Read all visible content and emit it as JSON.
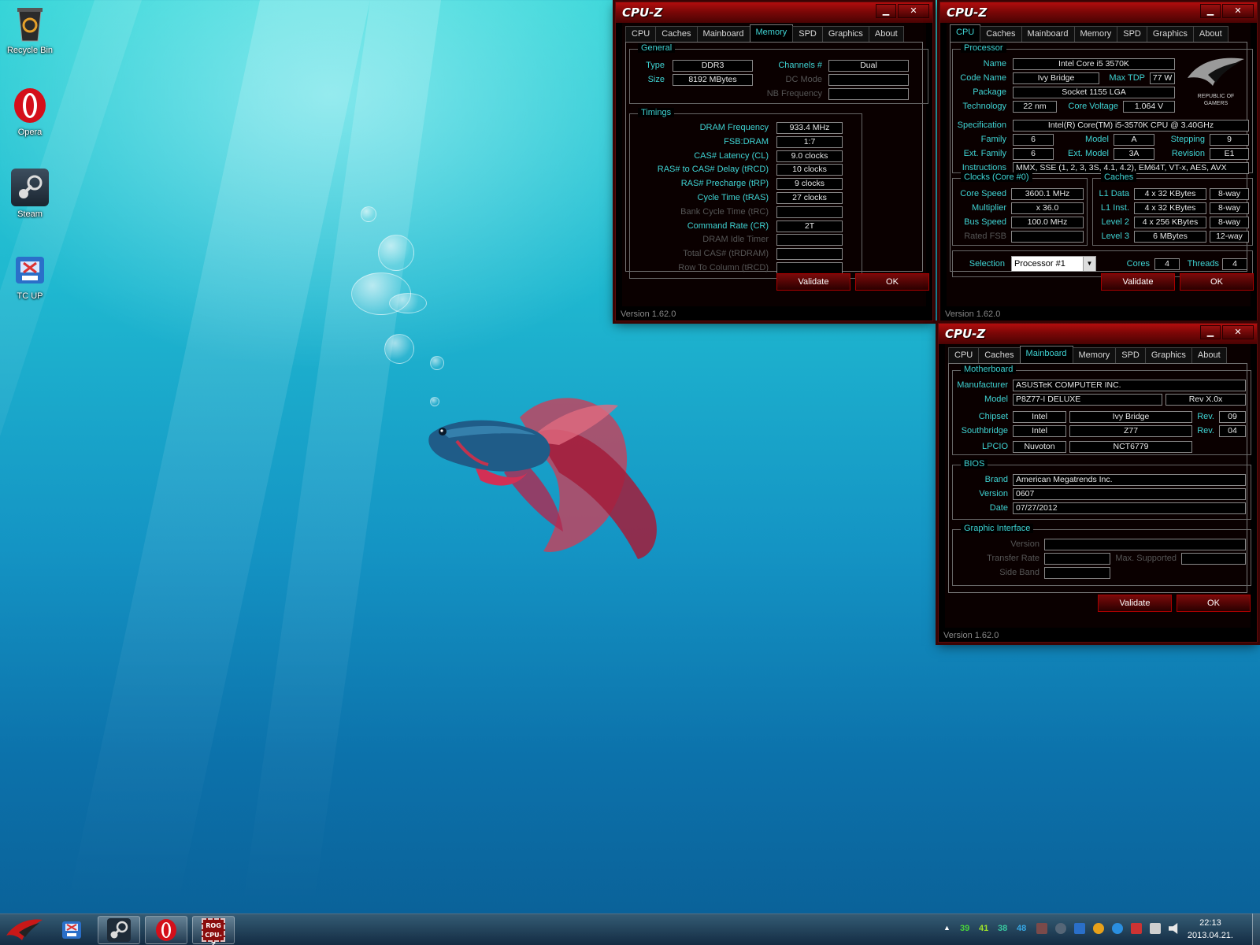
{
  "desktop": {
    "icons": [
      {
        "label": "Recycle Bin",
        "icon": "recycle-bin-icon"
      },
      {
        "label": "Opera",
        "icon": "opera-icon"
      },
      {
        "label": "Steam",
        "icon": "steam-icon"
      },
      {
        "label": "TC UP",
        "icon": "tc-up-icon"
      }
    ]
  },
  "common": {
    "window_title": "CPU-Z",
    "tabs": [
      "CPU",
      "Caches",
      "Mainboard",
      "Memory",
      "SPD",
      "Graphics",
      "About"
    ],
    "validate": "Validate",
    "ok": "OK",
    "version": "Version 1.62.0",
    "min_glyph": "▁",
    "close_glyph": "✕"
  },
  "memory": {
    "general_title": "General",
    "type_label": "Type",
    "type": "DDR3",
    "size_label": "Size",
    "size": "8192 MBytes",
    "channels_label": "Channels #",
    "channels": "Dual",
    "dcmode_label": "DC Mode",
    "dcmode": "",
    "nbfreq_label": "NB Frequency",
    "nbfreq": "",
    "timings_title": "Timings",
    "timings": [
      {
        "label": "DRAM Frequency",
        "value": "933.4 MHz",
        "dim": false
      },
      {
        "label": "FSB:DRAM",
        "value": "1:7",
        "dim": false
      },
      {
        "label": "CAS# Latency (CL)",
        "value": "9.0 clocks",
        "dim": false
      },
      {
        "label": "RAS# to CAS# Delay (tRCD)",
        "value": "10 clocks",
        "dim": false
      },
      {
        "label": "RAS# Precharge (tRP)",
        "value": "9 clocks",
        "dim": false
      },
      {
        "label": "Cycle Time (tRAS)",
        "value": "27 clocks",
        "dim": false
      },
      {
        "label": "Bank Cycle Time (tRC)",
        "value": "",
        "dim": true
      },
      {
        "label": "Command Rate (CR)",
        "value": "2T",
        "dim": false
      },
      {
        "label": "DRAM Idle Timer",
        "value": "",
        "dim": true
      },
      {
        "label": "Total CAS# (tRDRAM)",
        "value": "",
        "dim": true
      },
      {
        "label": "Row To Column (tRCD)",
        "value": "",
        "dim": true
      }
    ]
  },
  "cpu": {
    "processor_title": "Processor",
    "name_label": "Name",
    "name": "Intel Core i5 3570K",
    "codename_label": "Code Name",
    "codename": "Ivy Bridge",
    "maxtdp_label": "Max TDP",
    "maxtdp": "77 W",
    "package_label": "Package",
    "package": "Socket 1155 LGA",
    "technology_label": "Technology",
    "technology": "22 nm",
    "corevoltage_label": "Core Voltage",
    "corevoltage": "1.064 V",
    "spec_label": "Specification",
    "spec": "Intel(R) Core(TM) i5-3570K CPU @ 3.40GHz",
    "family_label": "Family",
    "family": "6",
    "model_label": "Model",
    "model": "A",
    "stepping_label": "Stepping",
    "stepping": "9",
    "extfamily_label": "Ext. Family",
    "extfamily": "6",
    "extmodel_label": "Ext. Model",
    "extmodel": "3A",
    "revision_label": "Revision",
    "revision": "E1",
    "instructions_label": "Instructions",
    "instructions": "MMX, SSE (1, 2, 3, 3S, 4.1, 4.2), EM64T, VT-x, AES, AVX",
    "logo_text_1": "REPUBLIC OF",
    "logo_text_2": "GAMERS",
    "clocks_title": "Clocks (Core #0)",
    "corespeed_label": "Core Speed",
    "corespeed": "3600.1 MHz",
    "multiplier_label": "Multiplier",
    "multiplier": "x 36.0",
    "busspeed_label": "Bus Speed",
    "busspeed": "100.0 MHz",
    "ratedfsb_label": "Rated FSB",
    "ratedfsb": "",
    "caches_title": "Caches",
    "l1data_label": "L1 Data",
    "l1data": "4 x 32 KBytes",
    "l1data_way": "8-way",
    "l1inst_label": "L1 Inst.",
    "l1inst": "4 x 32 KBytes",
    "l1inst_way": "8-way",
    "l2_label": "Level 2",
    "l2": "4 x 256 KBytes",
    "l2_way": "8-way",
    "l3_label": "Level 3",
    "l3": "6 MBytes",
    "l3_way": "12-way",
    "selection_label": "Selection",
    "selection": "Processor #1",
    "cores_label": "Cores",
    "cores": "4",
    "threads_label": "Threads",
    "threads": "4"
  },
  "mainboard": {
    "mb_title": "Motherboard",
    "manufacturer_label": "Manufacturer",
    "manufacturer": "ASUSTeK COMPUTER INC.",
    "model_label": "Model",
    "model": "P8Z77-I DELUXE",
    "model_rev": "Rev X.0x",
    "chipset_label": "Chipset",
    "chipset_vendor": "Intel",
    "chipset": "Ivy Bridge",
    "chipset_rev_label": "Rev.",
    "chipset_rev": "09",
    "southbridge_label": "Southbridge",
    "sb_vendor": "Intel",
    "sb": "Z77",
    "sb_rev_label": "Rev.",
    "sb_rev": "04",
    "lpcio_label": "LPCIO",
    "lpcio_vendor": "Nuvoton",
    "lpcio": "NCT6779",
    "bios_title": "BIOS",
    "brand_label": "Brand",
    "brand": "American Megatrends Inc.",
    "version_label": "Version",
    "version": "0607",
    "date_label": "Date",
    "date": "07/27/2012",
    "gi_title": "Graphic Interface",
    "gi_version_label": "Version",
    "gi_version": "",
    "gi_transfer_label": "Transfer Rate",
    "gi_transfer": "",
    "gi_max_label": "Max. Supported",
    "gi_max": "",
    "gi_sideband_label": "Side Band",
    "gi_sideband": ""
  },
  "taskbar": {
    "pinned": [
      "rog-start-icon",
      "tc-up-icon",
      "steam-icon",
      "opera-icon",
      "cpu-z-icon"
    ],
    "cpuz_badge": "ROG CPU-Z",
    "tray_numbers": [
      {
        "value": "39",
        "color": "#49d33b"
      },
      {
        "value": "41",
        "color": "#9fe32a"
      },
      {
        "value": "38",
        "color": "#39c8a0"
      },
      {
        "value": "48",
        "color": "#36a8e6"
      }
    ],
    "tray_expand": "▲",
    "time": "22:13",
    "date": "2013.04.21."
  }
}
